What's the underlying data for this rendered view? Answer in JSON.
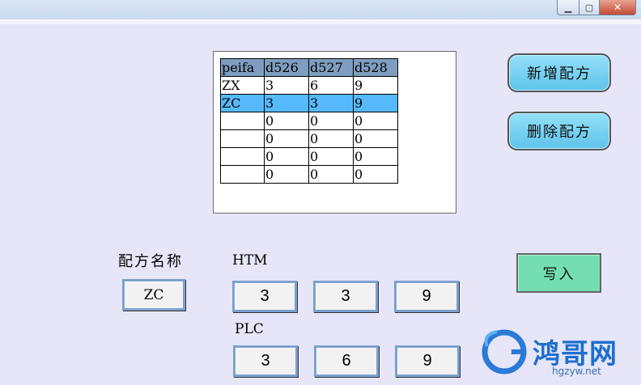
{
  "window": {
    "minimize_glyph": "▁",
    "maximize_glyph": "▢",
    "close_glyph": "✕"
  },
  "table": {
    "columns": [
      "peifa",
      "d526",
      "d527",
      "d528"
    ],
    "rows": [
      [
        "ZX",
        "3",
        "6",
        "9"
      ],
      [
        "ZC",
        "3",
        "3",
        "9"
      ],
      [
        "",
        "0",
        "0",
        "0"
      ],
      [
        "",
        "0",
        "0",
        "0"
      ],
      [
        "",
        "0",
        "0",
        "0"
      ],
      [
        "",
        "0",
        "0",
        "0"
      ]
    ],
    "selected_row": 1
  },
  "buttons": {
    "add_recipe": "新增配方",
    "delete_recipe": "删除配方",
    "write": "写入"
  },
  "form": {
    "recipe_name_label": "配方名称",
    "recipe_name_value": "ZC",
    "htm_label": "HTM",
    "htm_values": [
      "3",
      "3",
      "9"
    ],
    "plc_label": "PLC",
    "plc_values": [
      "3",
      "6",
      "9"
    ]
  },
  "watermark": {
    "brand": "鸿哥网",
    "url": "hgzyw.net"
  },
  "colors": {
    "background": "#e6e6f8",
    "header_row": "#7f9dbf",
    "selected_row": "#56b9fb",
    "pill_button": "#6fcff0",
    "write_button": "#74deb2",
    "field_border": "#7ba1cf"
  }
}
